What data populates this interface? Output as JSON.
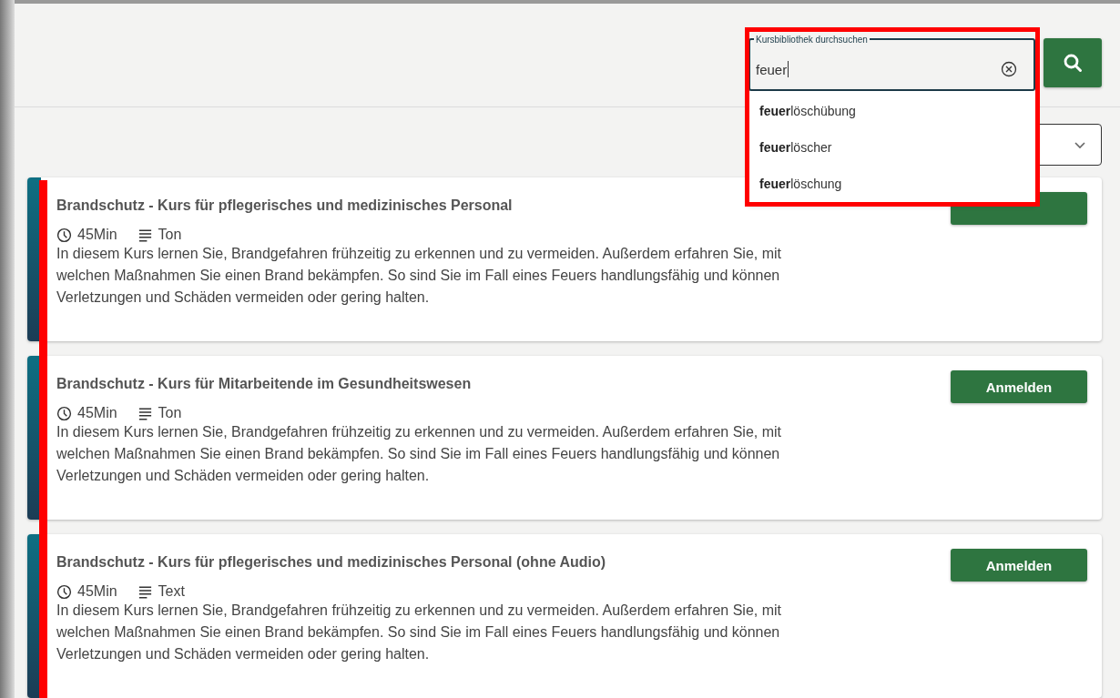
{
  "search": {
    "label": "Kursbibliothek durchsuchen",
    "value": "feuer",
    "suggestions": [
      {
        "text": "**feuer**löschübung"
      },
      {
        "text": "**feuer**löscher"
      },
      {
        "text": "**feuer**löschung"
      }
    ]
  },
  "courses": [
    {
      "title": "Brandschutz - Kurs für pflegerisches und medizinisches Personal",
      "duration": "45Min",
      "format": "Ton",
      "description": "In diesem Kurs lernen Sie, Brandgefahren frühzeitig zu erkennen und zu vermeiden. Außerdem erfahren Sie, mit welchen Maßnahmen Sie einen Brand bekämpfen. So sind Sie im Fall eines Feuers handlungsfähig und können Verletzungen und Schäden vermeiden oder gering halten."
    },
    {
      "title": "Brandschutz - Kurs für Mitarbeitende im Gesundheitswesen",
      "duration": "45Min",
      "format": "Ton",
      "description": "In diesem Kurs lernen Sie, Brandgefahren frühzeitig zu erkennen und zu vermeiden. Außerdem erfahren Sie, mit welchen Maßnahmen Sie einen Brand bekämpfen. So sind Sie im Fall eines Feuers handlungsfähig und können Verletzungen und Schäden vermeiden oder gering halten.",
      "button": "Anmelden"
    },
    {
      "title": "Brandschutz - Kurs für pflegerisches und medizinisches Personal (ohne Audio)",
      "duration": "45Min",
      "format": "Text",
      "description": "In diesem Kurs lernen Sie, Brandgefahren frühzeitig zu erkennen und zu vermeiden. Außerdem erfahren Sie, mit welchen Maßnahmen Sie einen Brand bekämpfen. So sind Sie im Fall eines Feuers handlungsfähig und können Verletzungen und Schäden vermeiden oder gering halten.",
      "button": "Anmelden"
    }
  ]
}
